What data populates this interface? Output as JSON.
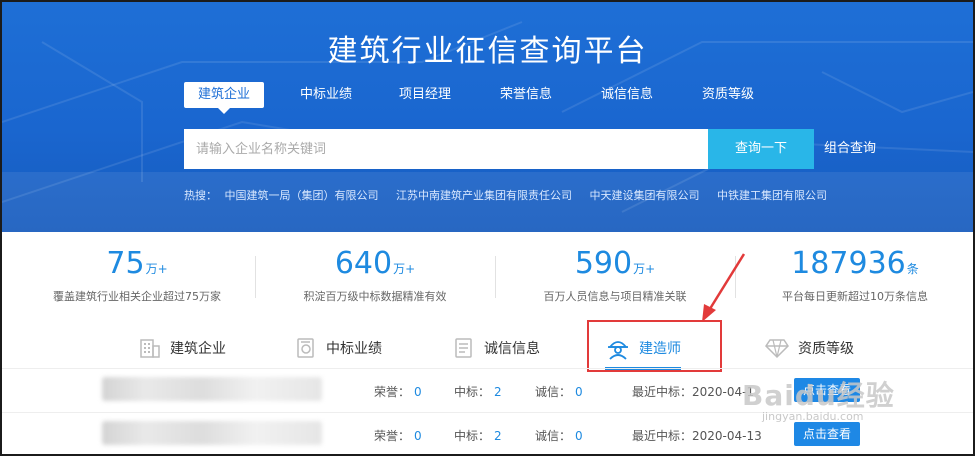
{
  "header": {
    "title": "建筑行业征信查询平台",
    "tabs": [
      "建筑企业",
      "中标业绩",
      "项目经理",
      "荣誉信息",
      "诚信信息",
      "资质等级"
    ],
    "active_tab": 0
  },
  "search": {
    "placeholder": "请输入企业名称关键词",
    "button_label": "查询一下",
    "combo_label": "组合查询"
  },
  "hot": {
    "label": "热搜：",
    "items": [
      "中国建筑一局（集团）有限公司",
      "江苏中南建筑产业集团有限责任公司",
      "中天建设集团有限公司",
      "中铁建工集团有限公司"
    ]
  },
  "stats": [
    {
      "number": "75",
      "unit": "万+",
      "desc": "覆盖建筑行业相关企业超过75万家"
    },
    {
      "number": "640",
      "unit": "万+",
      "desc": "积淀百万级中标数据精准有效"
    },
    {
      "number": "590",
      "unit": "万+",
      "desc": "百万人员信息与项目精准关联"
    },
    {
      "number": "187936",
      "unit": "条",
      "desc": "平台每日更新超过10万条信息"
    }
  ],
  "categories": [
    {
      "label": "建筑企业",
      "icon": "building-icon"
    },
    {
      "label": "中标业绩",
      "icon": "bid-document-icon"
    },
    {
      "label": "诚信信息",
      "icon": "credit-document-icon"
    },
    {
      "label": "建造师",
      "icon": "engineer-helmet-icon"
    },
    {
      "label": "资质等级",
      "icon": "diamond-icon"
    }
  ],
  "active_category": 3,
  "results": [
    {
      "honor_label": "荣誉：",
      "honor": "0",
      "bid_label": "中标：",
      "bid": "2",
      "credit_label": "诚信：",
      "credit": "0",
      "recent_label": "最近中标：",
      "recent": "2020-04-1",
      "button": "点击查看"
    },
    {
      "honor_label": "荣誉：",
      "honor": "0",
      "bid_label": "中标：",
      "bid": "2",
      "credit_label": "诚信：",
      "credit": "0",
      "recent_label": "最近中标：",
      "recent": "2020-04-13",
      "button": "点击查看"
    }
  ],
  "watermark": {
    "main": "Baidu经验",
    "sub": "jingyan.baidu.com"
  },
  "colors": {
    "brand_blue": "#1e6fd6",
    "accent": "#29b6e8",
    "highlight": "#e23a3a"
  }
}
